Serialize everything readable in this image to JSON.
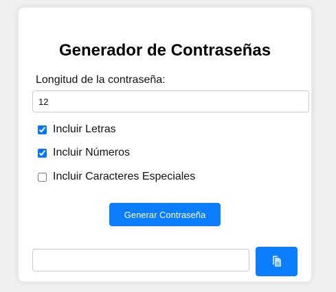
{
  "app": {
    "title": "Generador de Contraseñas"
  },
  "form": {
    "length_label": "Longitud de la contraseña:",
    "length_value": "12",
    "options": [
      {
        "label": "Incluir Letras",
        "checked": true
      },
      {
        "label": "Incluir Números",
        "checked": true
      },
      {
        "label": "Incluir Caracteres Especiales",
        "checked": false
      }
    ],
    "generate_label": "Generar Contraseña",
    "result_value": "",
    "copy_icon": "copy-icon"
  },
  "colors": {
    "accent": "#0b7eff",
    "background": "#f0f0f0",
    "card": "#ffffff"
  }
}
